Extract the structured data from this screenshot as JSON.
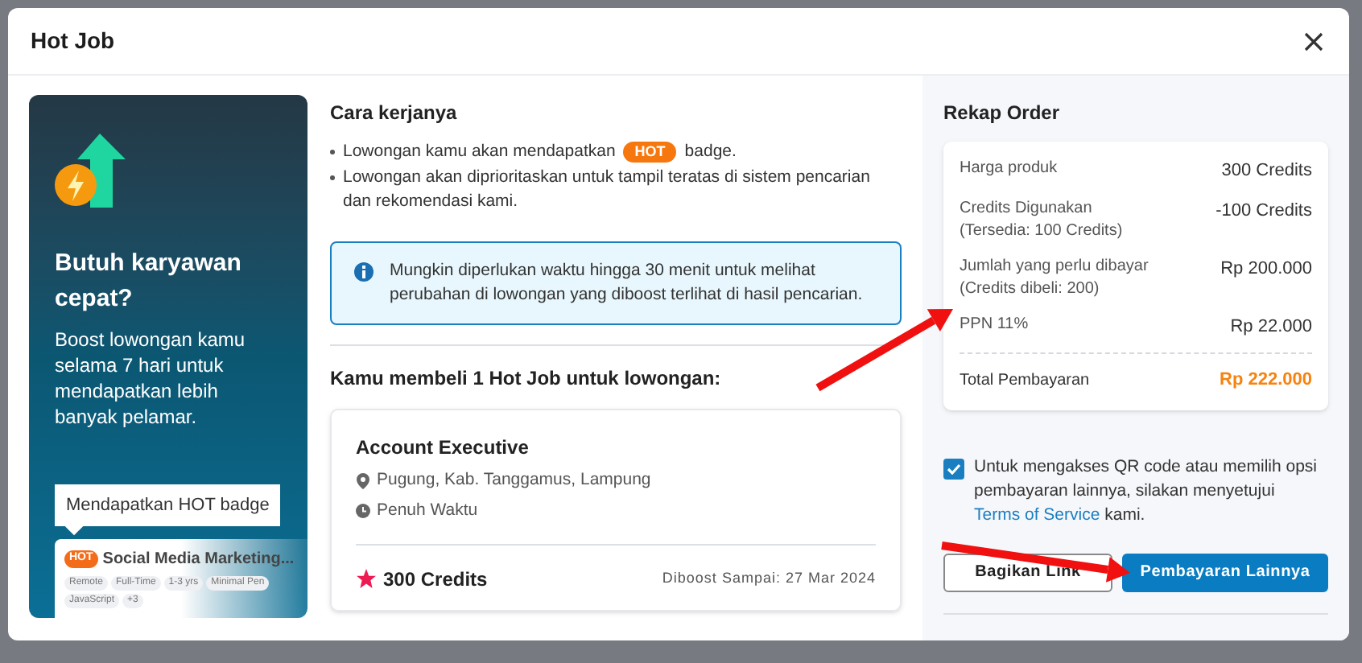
{
  "dialog": {
    "title": "Hot Job"
  },
  "promo": {
    "heading": "Butuh karyawan cepat?",
    "body": "Boost lowongan kamu selama 7 hari untuk mendapatkan lebih banyak pelamar.",
    "tooltip": "Mendapatkan HOT badge",
    "preview": {
      "badge": "HOT",
      "title": "Social Media Marketing...",
      "tags": [
        "Remote",
        "Full-Time",
        "1-3 yrs",
        "Minimal Pen",
        "JavaScript",
        "+3"
      ]
    }
  },
  "how_it_works": {
    "title": "Cara kerjanya",
    "bullets": [
      {
        "text": "Lowongan kamu akan mendapatkan",
        "badge": "HOT",
        "after": "badge."
      },
      {
        "text": "Lowongan akan diprioritaskan untuk tampil teratas di sistem pencarian dan rekomendasi kami."
      }
    ]
  },
  "info": "Mungkin diperlukan waktu hingga 30 menit untuk melihat perubahan di lowongan yang diboost terlihat di hasil pencarian.",
  "purchase": {
    "title": "Kamu membeli 1 Hot Job untuk lowongan:",
    "job": {
      "title": "Account Executive",
      "location": "Pugung, Kab. Tanggamus, Lampung",
      "type": "Penuh Waktu",
      "credits": "300 Credits",
      "boost_until": "Diboost Sampai: 27 Mar 2024"
    }
  },
  "order": {
    "title": "Rekap Order",
    "rows": [
      {
        "label": "Harga produk",
        "value": "300 Credits"
      },
      {
        "label": "Credits Digunakan",
        "note": "(Tersedia: 100 Credits)",
        "value": "-100 Credits"
      },
      {
        "label": "Jumlah yang perlu dibayar",
        "note": "(Credits dibeli: 200)",
        "value": "Rp 200.000"
      },
      {
        "label": "PPN 11%",
        "value": "Rp 22.000"
      }
    ],
    "total": {
      "label": "Total Pembayaran",
      "value": "Rp 222.000"
    }
  },
  "agreement": {
    "checked": true,
    "text": "Untuk mengakses QR code atau memilih opsi pembayaran lainnya, silakan menyetujui",
    "link": "Terms of Service",
    "after": "kami."
  },
  "buttons": [
    {
      "label": "Bagikan Link",
      "kind": "secondary"
    },
    {
      "label": "Pembayaran Lainnya",
      "kind": "primary"
    }
  ]
}
